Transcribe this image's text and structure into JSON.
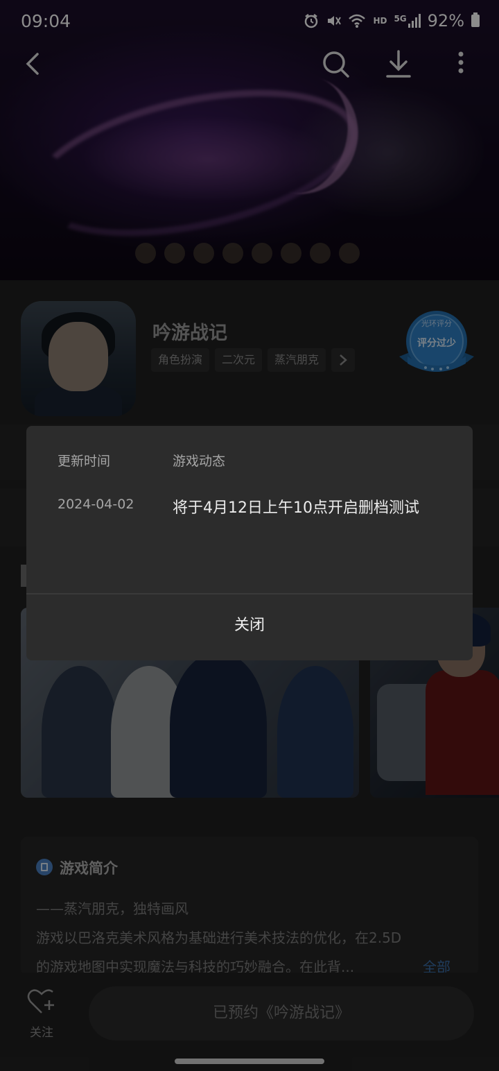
{
  "status_bar": {
    "time": "09:04",
    "network_hd": "HD",
    "network_5g": "5G",
    "battery": "92%"
  },
  "nav": {
    "back_icon": "back-arrow-icon",
    "search_icon": "search-icon",
    "download_icon": "download-icon",
    "more_icon": "more-vertical-icon"
  },
  "game": {
    "title": "吟游战记",
    "tags": [
      "角色扮演",
      "二次元",
      "蒸汽朋克"
    ],
    "rating_badge": {
      "line1": "光环评分",
      "line2": "评分过少"
    }
  },
  "intro": {
    "heading": "游戏简介",
    "line1": "——蒸汽朋克，独特画风",
    "line2": "游戏以巴洛克美术风格为基础进行美术技法的优化，在2.5D",
    "line3": "的游戏地图中实现魔法与科技的巧妙融合。在此背...",
    "more": "全部"
  },
  "bottom": {
    "follow_label": "关注",
    "reserve_button": "已预约《吟游战记》"
  },
  "modal": {
    "header_time": "更新时间",
    "header_news": "游戏动态",
    "date": "2024-04-02",
    "news": "将于4月12日上午10点开启删档测试",
    "close_button": "关闭"
  },
  "colors": {
    "background": "#1f1f1f",
    "modal": "#2c2c2c",
    "link_blue": "#3a6ea8"
  }
}
